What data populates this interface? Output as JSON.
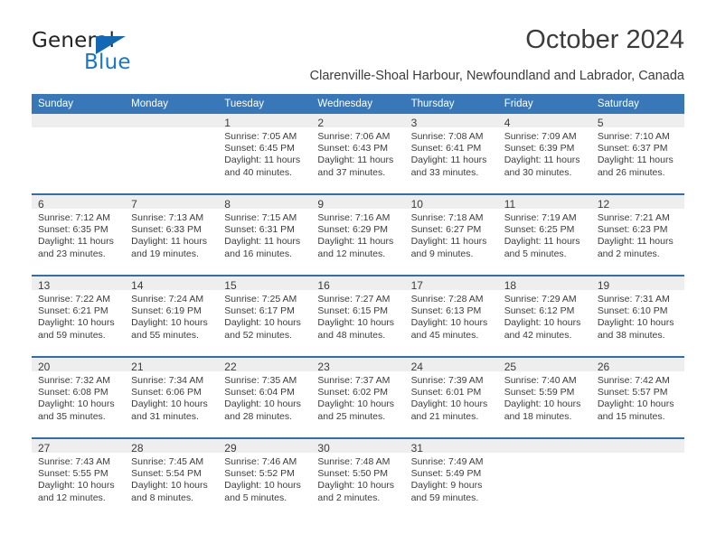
{
  "brand": {
    "name_part1": "General",
    "name_part2": "Blue",
    "triangle_color": "#1268b3",
    "blue_color": "#1877c4"
  },
  "header": {
    "title": "October 2024",
    "location": "Clarenville-Shoal Harbour, Newfoundland and Labrador, Canada",
    "header_bg": "#3878b8",
    "row_border": "#2f6fae",
    "daynum_bg": "#eeeeee"
  },
  "weekdays": [
    "Sunday",
    "Monday",
    "Tuesday",
    "Wednesday",
    "Thursday",
    "Friday",
    "Saturday"
  ],
  "labels": {
    "sunrise": "Sunrise:",
    "sunset": "Sunset:",
    "daylight": "Daylight:"
  },
  "weeks": [
    [
      {
        "day": ""
      },
      {
        "day": ""
      },
      {
        "day": "1",
        "sunrise": "Sunrise: 7:05 AM",
        "sunset": "Sunset: 6:45 PM",
        "daylight": "Daylight: 11 hours and 40 minutes."
      },
      {
        "day": "2",
        "sunrise": "Sunrise: 7:06 AM",
        "sunset": "Sunset: 6:43 PM",
        "daylight": "Daylight: 11 hours and 37 minutes."
      },
      {
        "day": "3",
        "sunrise": "Sunrise: 7:08 AM",
        "sunset": "Sunset: 6:41 PM",
        "daylight": "Daylight: 11 hours and 33 minutes."
      },
      {
        "day": "4",
        "sunrise": "Sunrise: 7:09 AM",
        "sunset": "Sunset: 6:39 PM",
        "daylight": "Daylight: 11 hours and 30 minutes."
      },
      {
        "day": "5",
        "sunrise": "Sunrise: 7:10 AM",
        "sunset": "Sunset: 6:37 PM",
        "daylight": "Daylight: 11 hours and 26 minutes."
      }
    ],
    [
      {
        "day": "6",
        "sunrise": "Sunrise: 7:12 AM",
        "sunset": "Sunset: 6:35 PM",
        "daylight": "Daylight: 11 hours and 23 minutes."
      },
      {
        "day": "7",
        "sunrise": "Sunrise: 7:13 AM",
        "sunset": "Sunset: 6:33 PM",
        "daylight": "Daylight: 11 hours and 19 minutes."
      },
      {
        "day": "8",
        "sunrise": "Sunrise: 7:15 AM",
        "sunset": "Sunset: 6:31 PM",
        "daylight": "Daylight: 11 hours and 16 minutes."
      },
      {
        "day": "9",
        "sunrise": "Sunrise: 7:16 AM",
        "sunset": "Sunset: 6:29 PM",
        "daylight": "Daylight: 11 hours and 12 minutes."
      },
      {
        "day": "10",
        "sunrise": "Sunrise: 7:18 AM",
        "sunset": "Sunset: 6:27 PM",
        "daylight": "Daylight: 11 hours and 9 minutes."
      },
      {
        "day": "11",
        "sunrise": "Sunrise: 7:19 AM",
        "sunset": "Sunset: 6:25 PM",
        "daylight": "Daylight: 11 hours and 5 minutes."
      },
      {
        "day": "12",
        "sunrise": "Sunrise: 7:21 AM",
        "sunset": "Sunset: 6:23 PM",
        "daylight": "Daylight: 11 hours and 2 minutes."
      }
    ],
    [
      {
        "day": "13",
        "sunrise": "Sunrise: 7:22 AM",
        "sunset": "Sunset: 6:21 PM",
        "daylight": "Daylight: 10 hours and 59 minutes."
      },
      {
        "day": "14",
        "sunrise": "Sunrise: 7:24 AM",
        "sunset": "Sunset: 6:19 PM",
        "daylight": "Daylight: 10 hours and 55 minutes."
      },
      {
        "day": "15",
        "sunrise": "Sunrise: 7:25 AM",
        "sunset": "Sunset: 6:17 PM",
        "daylight": "Daylight: 10 hours and 52 minutes."
      },
      {
        "day": "16",
        "sunrise": "Sunrise: 7:27 AM",
        "sunset": "Sunset: 6:15 PM",
        "daylight": "Daylight: 10 hours and 48 minutes."
      },
      {
        "day": "17",
        "sunrise": "Sunrise: 7:28 AM",
        "sunset": "Sunset: 6:13 PM",
        "daylight": "Daylight: 10 hours and 45 minutes."
      },
      {
        "day": "18",
        "sunrise": "Sunrise: 7:29 AM",
        "sunset": "Sunset: 6:12 PM",
        "daylight": "Daylight: 10 hours and 42 minutes."
      },
      {
        "day": "19",
        "sunrise": "Sunrise: 7:31 AM",
        "sunset": "Sunset: 6:10 PM",
        "daylight": "Daylight: 10 hours and 38 minutes."
      }
    ],
    [
      {
        "day": "20",
        "sunrise": "Sunrise: 7:32 AM",
        "sunset": "Sunset: 6:08 PM",
        "daylight": "Daylight: 10 hours and 35 minutes."
      },
      {
        "day": "21",
        "sunrise": "Sunrise: 7:34 AM",
        "sunset": "Sunset: 6:06 PM",
        "daylight": "Daylight: 10 hours and 31 minutes."
      },
      {
        "day": "22",
        "sunrise": "Sunrise: 7:35 AM",
        "sunset": "Sunset: 6:04 PM",
        "daylight": "Daylight: 10 hours and 28 minutes."
      },
      {
        "day": "23",
        "sunrise": "Sunrise: 7:37 AM",
        "sunset": "Sunset: 6:02 PM",
        "daylight": "Daylight: 10 hours and 25 minutes."
      },
      {
        "day": "24",
        "sunrise": "Sunrise: 7:39 AM",
        "sunset": "Sunset: 6:01 PM",
        "daylight": "Daylight: 10 hours and 21 minutes."
      },
      {
        "day": "25",
        "sunrise": "Sunrise: 7:40 AM",
        "sunset": "Sunset: 5:59 PM",
        "daylight": "Daylight: 10 hours and 18 minutes."
      },
      {
        "day": "26",
        "sunrise": "Sunrise: 7:42 AM",
        "sunset": "Sunset: 5:57 PM",
        "daylight": "Daylight: 10 hours and 15 minutes."
      }
    ],
    [
      {
        "day": "27",
        "sunrise": "Sunrise: 7:43 AM",
        "sunset": "Sunset: 5:55 PM",
        "daylight": "Daylight: 10 hours and 12 minutes."
      },
      {
        "day": "28",
        "sunrise": "Sunrise: 7:45 AM",
        "sunset": "Sunset: 5:54 PM",
        "daylight": "Daylight: 10 hours and 8 minutes."
      },
      {
        "day": "29",
        "sunrise": "Sunrise: 7:46 AM",
        "sunset": "Sunset: 5:52 PM",
        "daylight": "Daylight: 10 hours and 5 minutes."
      },
      {
        "day": "30",
        "sunrise": "Sunrise: 7:48 AM",
        "sunset": "Sunset: 5:50 PM",
        "daylight": "Daylight: 10 hours and 2 minutes."
      },
      {
        "day": "31",
        "sunrise": "Sunrise: 7:49 AM",
        "sunset": "Sunset: 5:49 PM",
        "daylight": "Daylight: 9 hours and 59 minutes."
      },
      {
        "day": ""
      },
      {
        "day": ""
      }
    ]
  ]
}
